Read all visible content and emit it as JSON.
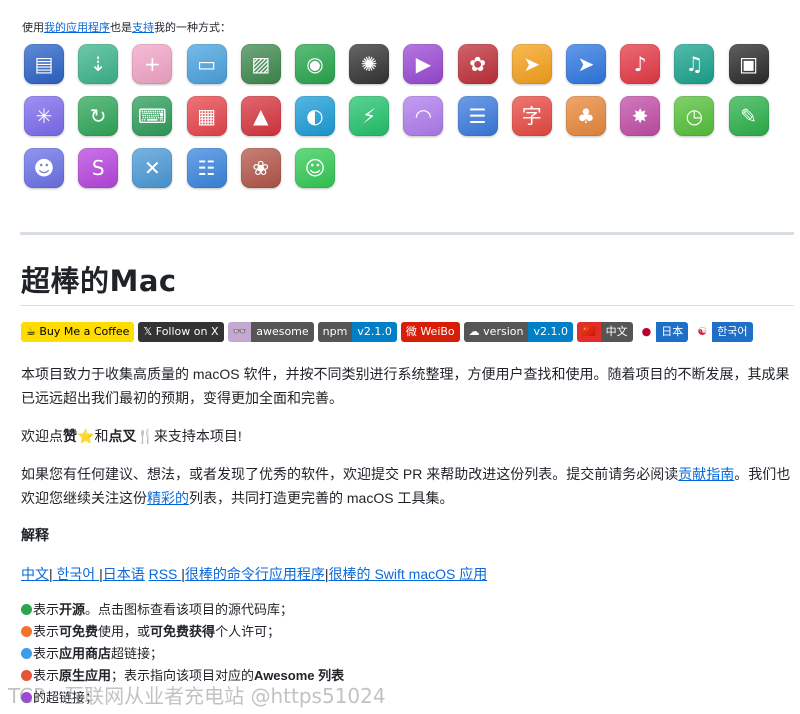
{
  "intro": {
    "prefix": "使用",
    "link1": "我的应用程序",
    "middle": "也是",
    "link2": "支持",
    "suffix": "我的一种方式："
  },
  "apps": [
    {
      "name": "screen-app-icon",
      "bg": "#2b63c9",
      "glyph": "▤"
    },
    {
      "name": "zip-app-icon",
      "bg": "#3cb68c",
      "glyph": "⇣"
    },
    {
      "name": "image-add-app-icon",
      "bg": "#f3a6c8",
      "glyph": "+"
    },
    {
      "name": "display-app-icon",
      "bg": "#4aa3e0",
      "glyph": "▭"
    },
    {
      "name": "pattern-app-icon",
      "bg": "#3f8a4f",
      "glyph": "▨"
    },
    {
      "name": "lock-app-icon",
      "bg": "#27a74d",
      "glyph": "◉"
    },
    {
      "name": "aperture-app-icon",
      "bg": "#333333",
      "glyph": "✺"
    },
    {
      "name": "video-app-icon",
      "bg": "#9b49d6",
      "glyph": "▶"
    },
    {
      "name": "pinwheel-app-icon",
      "bg": "#c0303a",
      "glyph": "✿"
    },
    {
      "name": "cursor-md-app-icon",
      "bg": "#f7a21b",
      "glyph": "➤"
    },
    {
      "name": "pointer-app-icon",
      "bg": "#2e78e3",
      "glyph": "➤"
    },
    {
      "name": "music-app-icon",
      "bg": "#e63946",
      "glyph": "♪"
    },
    {
      "name": "music-teal-app-icon",
      "bg": "#1aa58f",
      "glyph": "♫"
    },
    {
      "name": "terminal-app-icon",
      "bg": "#2a2a2a",
      "glyph": "▣"
    },
    {
      "name": "click-app-icon",
      "bg": "#7c6cf0",
      "glyph": "✳"
    },
    {
      "name": "refresh-app-icon",
      "bg": "#2fa85a",
      "glyph": "↻"
    },
    {
      "name": "keyboard-app-icon",
      "bg": "#2e9e5b",
      "glyph": "⌨"
    },
    {
      "name": "calendar-app-icon",
      "bg": "#e7454b",
      "glyph": "▦"
    },
    {
      "name": "photo-app-icon",
      "bg": "#d8353f",
      "glyph": "▲"
    },
    {
      "name": "edge-app-icon",
      "bg": "#1b9ed9",
      "glyph": "◐"
    },
    {
      "name": "battery-app-icon",
      "bg": "#23c46d",
      "glyph": "⚡"
    },
    {
      "name": "rss-app-icon",
      "bg": "#b07df0",
      "glyph": "◠"
    },
    {
      "name": "list-app-icon",
      "bg": "#3b7be0",
      "glyph": "☰"
    },
    {
      "name": "font-app-icon",
      "bg": "#e94a42",
      "glyph": "字"
    },
    {
      "name": "bird-app-icon",
      "bg": "#e9893c",
      "glyph": "♣"
    },
    {
      "name": "burst-app-icon",
      "bg": "#c34da8",
      "glyph": "✸"
    },
    {
      "name": "screenshot-app-icon",
      "bg": "#55c23a",
      "glyph": "◷"
    },
    {
      "name": "draw-app-icon",
      "bg": "#2cb24b",
      "glyph": "✎"
    },
    {
      "name": "voice-app-icon",
      "bg": "#6b72e8",
      "glyph": "☻"
    },
    {
      "name": "s-app-icon",
      "bg": "#b845e0",
      "glyph": "S"
    },
    {
      "name": "tools-app-icon",
      "bg": "#4a9ad8",
      "glyph": "✕"
    },
    {
      "name": "form-app-icon",
      "bg": "#3a86e0",
      "glyph": "☷"
    },
    {
      "name": "art-app-icon",
      "bg": "#b4564a",
      "glyph": "❀"
    },
    {
      "name": "smile-app-icon",
      "bg": "#33cc55",
      "glyph": "☺"
    }
  ],
  "title": "超棒的Mac",
  "badges": [
    {
      "name": "badge-buy-me-a-coffee",
      "left": "☕ Buy Me a Coffee",
      "leftBg": "#ffdd00",
      "leftColor": "#000000"
    },
    {
      "name": "badge-follow-on-x",
      "left": "𝕏 Follow on X",
      "leftBg": "#333333",
      "leftColor": "#ffffff"
    },
    {
      "name": "badge-awesome",
      "left": "👓",
      "right": "awesome",
      "leftBg": "#c5a8cf",
      "rightBg": "#555555",
      "leftColor": "#222222"
    },
    {
      "name": "badge-npm",
      "left": "npm",
      "right": "v2.1.0",
      "leftBg": "#555555",
      "rightBg": "#007ec6",
      "leftColor": "#ffffff"
    },
    {
      "name": "badge-weibo",
      "left": "微 WeiBo",
      "leftBg": "#d81e06",
      "leftColor": "#ffffff"
    },
    {
      "name": "badge-version",
      "left": "☁ version",
      "right": "v2.1.0",
      "leftBg": "#555555",
      "rightBg": "#007ec6",
      "leftColor": "#ffffff"
    },
    {
      "name": "badge-chinese",
      "left": "🇨🇳",
      "right": "中文",
      "leftBg": "#e52d27",
      "rightBg": "#555555",
      "leftColor": "#ffdd00"
    },
    {
      "name": "badge-japanese",
      "left": "●",
      "right": "日本",
      "leftBg": "#ffffff",
      "rightBg": "#1f6fc7",
      "leftColor": "#bc002d"
    },
    {
      "name": "badge-korean",
      "left": "☯",
      "right": "한국어",
      "leftBg": "#ffffff",
      "rightBg": "#1f6fc7",
      "leftColor": "#cd2e3a"
    }
  ],
  "para1": "本项目致力于收集高质量的 macOS 软件，并按不同类别进行系统整理，方便用户查找和使用。随着项目的不断发展，其成果已远远超出我们最初的预期，变得更加全面和完善。",
  "para2": {
    "t1": "欢迎点",
    "b1": "赞",
    "star": "⭐",
    "t2": "和",
    "b2": "点叉",
    "fork": "🍴",
    "t3": "来支持本项目!"
  },
  "para3": {
    "t1": "如果您有任何建议、想法，或者发现了优秀的软件，欢迎提交 PR 来帮助改进这份列表。提交前请务必阅读",
    "link1": "贡献指南",
    "t2": "。我们也欢迎您继续关注这份",
    "link2": "精彩的",
    "t3": "列表，共同打造更完善的 macOS 工具集。"
  },
  "explain_heading": "解释",
  "links": {
    "l1": "中文",
    "l2": " 한국어 ",
    "l3": "日本语",
    "l4": " RSS ",
    "l5": "很棒的命令行应用程序",
    "l6": "很棒的 Swift macOS 应用",
    "sep": "|"
  },
  "legend": [
    {
      "name": "legend-open-source",
      "color": "#2da44e",
      "pre": "表示",
      "bold": "开源",
      "post": "。点击图标查看该项目的源代码库；"
    },
    {
      "name": "legend-free",
      "color": "#f1742d",
      "pre": "表示",
      "bold": "可免费",
      "mid": "使用，或",
      "bold2": "可免费获得",
      "post": "个人许可；"
    },
    {
      "name": "legend-app-store",
      "color": "#3c9de8",
      "pre": "表示",
      "bold": "应用商店",
      "post": "超链接；"
    },
    {
      "name": "legend-native",
      "color": "#e5533a",
      "pre": "表示",
      "bold": "原生应用",
      "mid": "；表示指向该项目对应的",
      "bold2": "Awesome 列表",
      "post": ""
    },
    {
      "name": "legend-hyperlink",
      "color": "#9b49d6",
      "pre": "",
      "bold": "",
      "post": "的超链接；"
    }
  ],
  "watermark": "TCP · 互联网从业者充电站 @https51024"
}
